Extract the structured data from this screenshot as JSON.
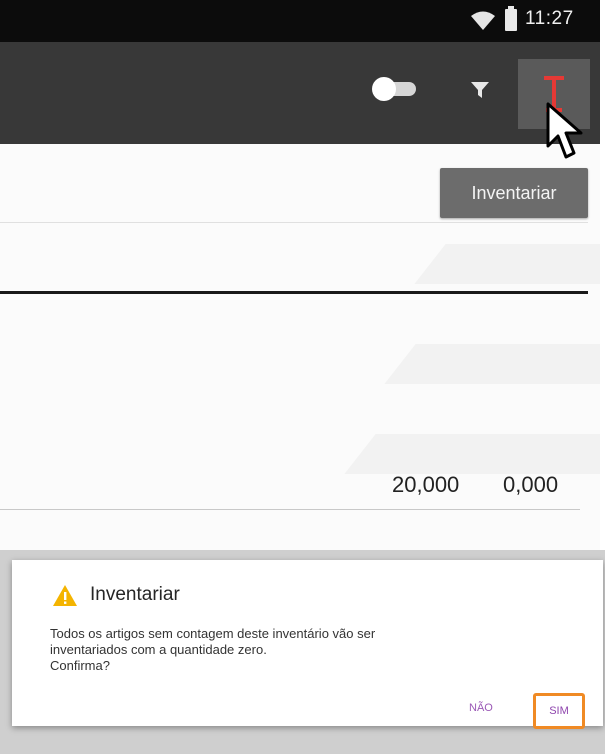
{
  "status_bar": {
    "time": "11:27",
    "icons": [
      "wifi-icon",
      "battery-icon"
    ]
  },
  "app_bar": {
    "actions": [
      "toggle-switch",
      "filter-icon",
      "inventory-tee-icon"
    ],
    "accent_color": "#e53935"
  },
  "content": {
    "inventariar_button": "Inventariar",
    "row": {
      "value_1": "20,000",
      "value_2": "0,000"
    }
  },
  "dialog": {
    "title": "Inventariar",
    "message_lines": [
      "Todos os artigos sem contagem deste inventário vão ser",
      "inventariados com a quantidade zero.",
      "Confirma?"
    ],
    "no_label": "NÃO",
    "yes_label": "SIM",
    "warning_color": "#f4b400",
    "highlight_color": "#f08a24"
  }
}
